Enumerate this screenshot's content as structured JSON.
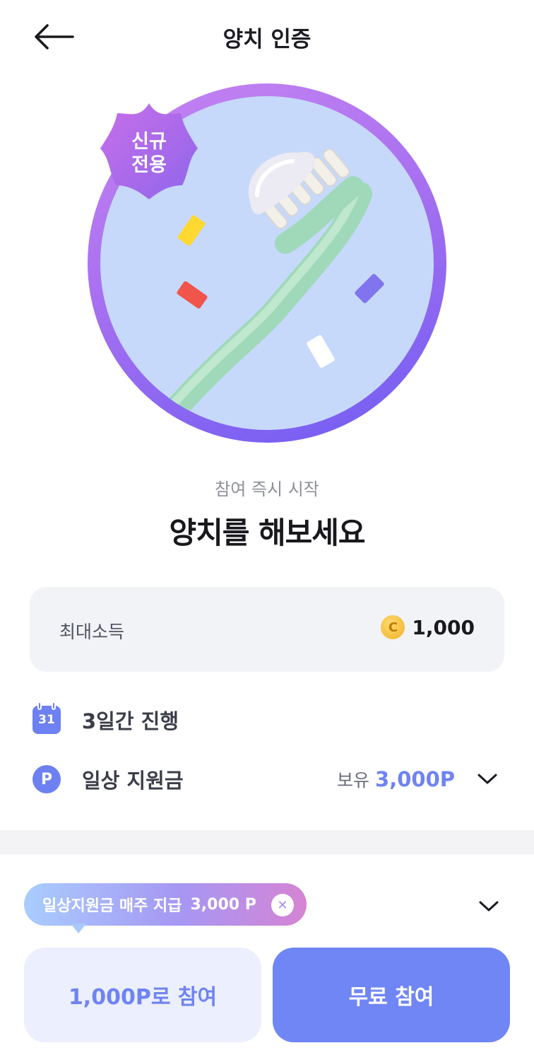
{
  "header": {
    "title": "양치 인증",
    "back_icon": "arrow-left-icon"
  },
  "hero": {
    "badge_line1": "신규",
    "badge_line2": "전용",
    "illustration": "toothbrush-icon",
    "colors": {
      "ring_start": "#c684f2",
      "ring_end": "#6e5cf3",
      "disc": "#c6d9fb"
    }
  },
  "challenge": {
    "subtitle": "참여 즉시 시작",
    "title": "양치를 해보세요"
  },
  "income": {
    "label": "최대소득",
    "coin_symbol": "C",
    "value": "1,000"
  },
  "details": {
    "calendar_day": "31",
    "duration": "3일간 진행",
    "support_icon_letter": "P",
    "support_label": "일상 지원금",
    "hold_label": "보유",
    "hold_value": "3,000P"
  },
  "tooltip": {
    "text": "일상지원금 매주 지급",
    "amount": "3,000 P",
    "close_symbol": "✕"
  },
  "actions": {
    "paid_label": "1,000P로 참여",
    "free_label": "무료 참여"
  },
  "colors": {
    "accent": "#7086f4",
    "accent_text": "#6f83f2",
    "paid_button_bg": "#ebeffe"
  }
}
